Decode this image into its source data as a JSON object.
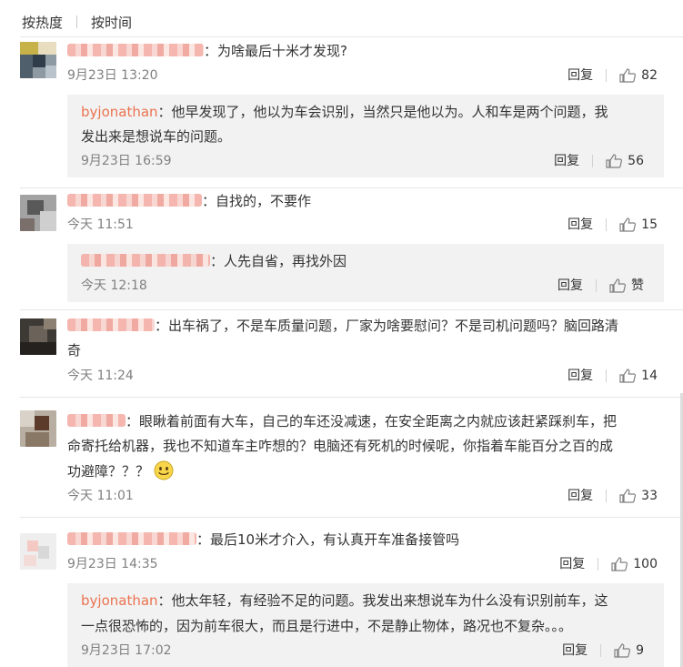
{
  "sort": {
    "hot": "按热度",
    "time": "按时间"
  },
  "labels": {
    "reply": "回复"
  },
  "colors": {
    "username": "#eb7350",
    "meta": "#808080",
    "sub_bg": "#f2f2f2"
  },
  "comments": [
    {
      "user": "",
      "text": "为啥最后十米才发现?",
      "time": "9月23日 13:20",
      "likes": "82",
      "sub": {
        "user": "byjonathan",
        "text_line1": "他早发现了，他以为车会识别，当然只是他以为。人和车是两个问题，我",
        "text_line2": "发出来是想说车的问题。",
        "time": "9月23日 16:59",
        "likes": "56"
      }
    },
    {
      "user": "",
      "text": "自找的，不要作",
      "time": "今天 11:51",
      "likes": "15",
      "sub": {
        "user": "",
        "text_line1": "人先自省，再找外因",
        "time": "今天 12:18",
        "likes": "赞"
      }
    },
    {
      "user": "",
      "text_line1": "出车祸了，不是车质量问题，厂家为啥要慰问？不是司机问题吗？脑回路清",
      "text_line2": "奇",
      "time": "今天 11:24",
      "likes": "14"
    },
    {
      "user": "",
      "text_line1": "眼瞅着前面有大车，自己的车还没减速，在安全距离之内就应该赶紧踩刹车，把",
      "text_line2": "命寄托给机器，我也不知道车主咋想的？电脑还有死机的时候呢，你指着车能百分之百的成",
      "text_line3": "功避障？？？",
      "emoji": "smile-emoji",
      "time": "今天 11:01",
      "likes": "33"
    },
    {
      "user": "",
      "text": "最后10米才介入，有认真开车准备接管吗",
      "time": "9月23日 14:35",
      "likes": "100",
      "sub": {
        "user": "byjonathan",
        "text_line1": "他太年轻，有经验不足的问题。我发出来想说车为什么没有识别前车，这",
        "text_line2": "一点很恐怖的，因为前车很大，而且是行进中，不是静止物体，路况也不复杂。。。",
        "time": "9月23日 17:02",
        "likes": "9"
      }
    }
  ]
}
